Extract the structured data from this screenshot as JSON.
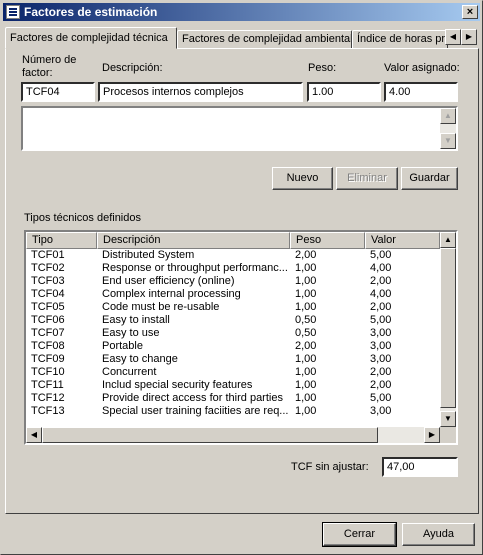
{
  "window": {
    "title": "Factores de estimación",
    "close": "×"
  },
  "tabs": [
    {
      "label": "Factores de complejidad técnica"
    },
    {
      "label": "Factores de complejidad ambiental"
    },
    {
      "label": "Índice de horas pr"
    }
  ],
  "form": {
    "numero_label": "Número de factor:",
    "descripcion_label": "Descripción:",
    "peso_label": "Peso:",
    "valor_label": "Valor asignado:",
    "numero_value": "TCF04",
    "descripcion_value": "Procesos internos complejos",
    "peso_value": "1.00",
    "valor_value": "4.00",
    "notes_value": ""
  },
  "actions": {
    "nuevo": "Nuevo",
    "eliminar": "Eliminar",
    "guardar": "Guardar"
  },
  "table": {
    "title": "Tipos técnicos definidos",
    "headers": [
      "Tipo",
      "Descripción",
      "Peso",
      "Valor"
    ],
    "rows": [
      [
        "TCF01",
        "Distributed System",
        "2,00",
        "5,00"
      ],
      [
        "TCF02",
        "Response or throughput performanc...",
        "1,00",
        "4,00"
      ],
      [
        "TCF03",
        "End user efficiency (online)",
        "1,00",
        "2,00"
      ],
      [
        "TCF04",
        "Complex internal processing",
        "1,00",
        "4,00"
      ],
      [
        "TCF05",
        "Code must be re-usable",
        "1,00",
        "2,00"
      ],
      [
        "TCF06",
        "Easy to install",
        "0,50",
        "5,00"
      ],
      [
        "TCF07",
        "Easy to use",
        "0,50",
        "3,00"
      ],
      [
        "TCF08",
        "Portable",
        "2,00",
        "3,00"
      ],
      [
        "TCF09",
        "Easy to change",
        "1,00",
        "3,00"
      ],
      [
        "TCF10",
        "Concurrent",
        "1,00",
        "2,00"
      ],
      [
        "TCF11",
        "Includ special security features",
        "1,00",
        "2,00"
      ],
      [
        "TCF12",
        "Provide direct access for third parties",
        "1,00",
        "5,00"
      ],
      [
        "TCF13",
        "Special user training faciities are req...",
        "1,00",
        "3,00"
      ]
    ]
  },
  "summary": {
    "tcf_label": "TCF sin ajustar:",
    "tcf_value": "47,00"
  },
  "footer": {
    "cerrar": "Cerrar",
    "ayuda": "Ayuda"
  },
  "icons": {
    "up": "▲",
    "down": "▼",
    "left": "◀",
    "right": "▶"
  }
}
